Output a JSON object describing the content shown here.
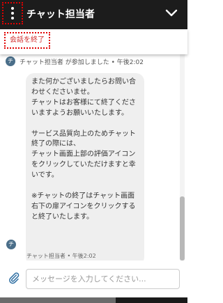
{
  "header": {
    "title": "チャット担当者",
    "menu_icon": "vertical-dots-icon",
    "collapse_icon": "chevron-down-icon"
  },
  "menu": {
    "end_chat_label": "会話を終了"
  },
  "messages": {
    "agent_avatar_char": "チ",
    "joined_notice": "チャット担当者 が参加しました • 午後2:02",
    "bubble_paragraphs": [
      "また何かございましたらお問い合わせくださいませ。\nチャットはお客様にて終了くださいますようお願いいたします。",
      "サービス品質向上のためチャット終了の際には、\nチャット画面上部の評価アイコンをクリックしていただけますと幸いです。",
      "※チャットの終了はチャット画面右下の扉アイコンをクリックすると終了いたします。"
    ],
    "bubble_meta": "チャット担当者 • 午後2:02"
  },
  "composer": {
    "attach_icon": "paperclip-icon",
    "placeholder": "メッセージを入力してください..."
  },
  "colors": {
    "header_bg": "#1c1c1c",
    "highlight_border": "#e00000",
    "end_chat_text": "#d32f2f",
    "avatar_bg": "#4a6e89",
    "bubble_bg": "#efefef",
    "icon_blue": "#2f6fa3"
  }
}
